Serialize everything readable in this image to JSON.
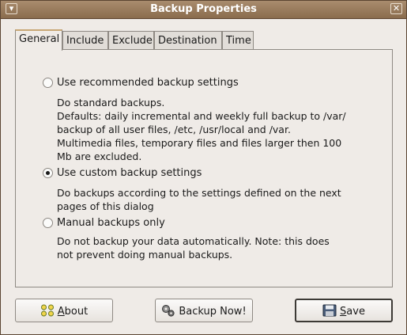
{
  "window": {
    "title": "Backup Properties"
  },
  "tabs": [
    {
      "label": "General",
      "active": true
    },
    {
      "label": "Include",
      "active": false
    },
    {
      "label": "Exclude",
      "active": false
    },
    {
      "label": "Destination",
      "active": false
    },
    {
      "label": "Time",
      "active": false
    }
  ],
  "general": {
    "options": [
      {
        "label": "Use recommended backup settings",
        "selected": false,
        "description": [
          "Do standard backups.",
          "Defaults: daily incremental and weekly full backup to /var/",
          "backup of all user files, /etc, /usr/local and /var.",
          "Multimedia files, temporary files and files larger then 100",
          "Mb are excluded."
        ]
      },
      {
        "label": "Use custom backup settings",
        "selected": true,
        "description": [
          "Do backups according to the settings defined on the next",
          "pages of this dialog"
        ]
      },
      {
        "label": "Manual backups only",
        "selected": false,
        "description": [
          "Do not backup your data automatically. Note: this does",
          "not prevent doing manual backups."
        ]
      }
    ]
  },
  "buttons": {
    "about": {
      "label_first": "A",
      "label_rest": "bout",
      "icon": "about-icon"
    },
    "backup_now": {
      "label": "Backup Now!",
      "icon": "backup-gears-icon"
    },
    "save": {
      "label_first": "S",
      "label_rest": "ave",
      "icon": "floppy-disk-icon"
    }
  },
  "colors": {
    "titlebar": "#8a6c4d",
    "tab_accent": "#c8a776",
    "dialog_bg": "#efebe7"
  }
}
